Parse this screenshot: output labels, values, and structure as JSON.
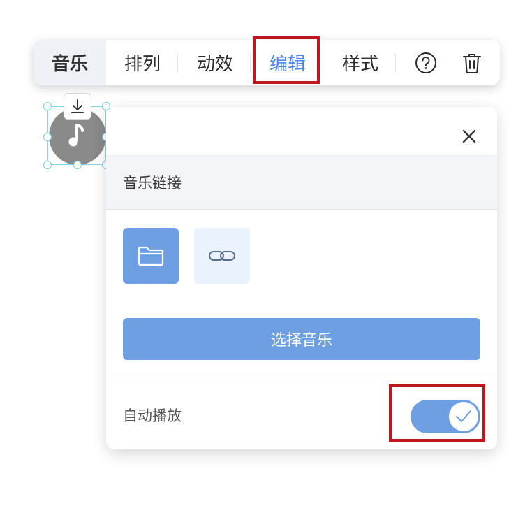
{
  "toolbar": {
    "music_label": "音乐",
    "arrange_label": "排列",
    "animation_label": "动效",
    "edit_label": "编辑",
    "style_label": "样式",
    "help_icon": "question-circle-icon",
    "delete_icon": "trash-icon",
    "active_color": "#4a86e8"
  },
  "canvas": {
    "element_icon": "music-note-icon",
    "download_icon": "download-icon"
  },
  "panel": {
    "close_icon": "close-icon",
    "section_title": "音乐链接",
    "source_buttons": [
      {
        "icon": "folder-icon",
        "selected": true
      },
      {
        "icon": "link-icon",
        "selected": false
      }
    ],
    "select_button_label": "选择音乐",
    "autoplay_label": "自动播放",
    "autoplay_on": true,
    "accent_color": "#6f9fe3"
  },
  "annotations": {
    "highlight_color": "#c0171d"
  }
}
